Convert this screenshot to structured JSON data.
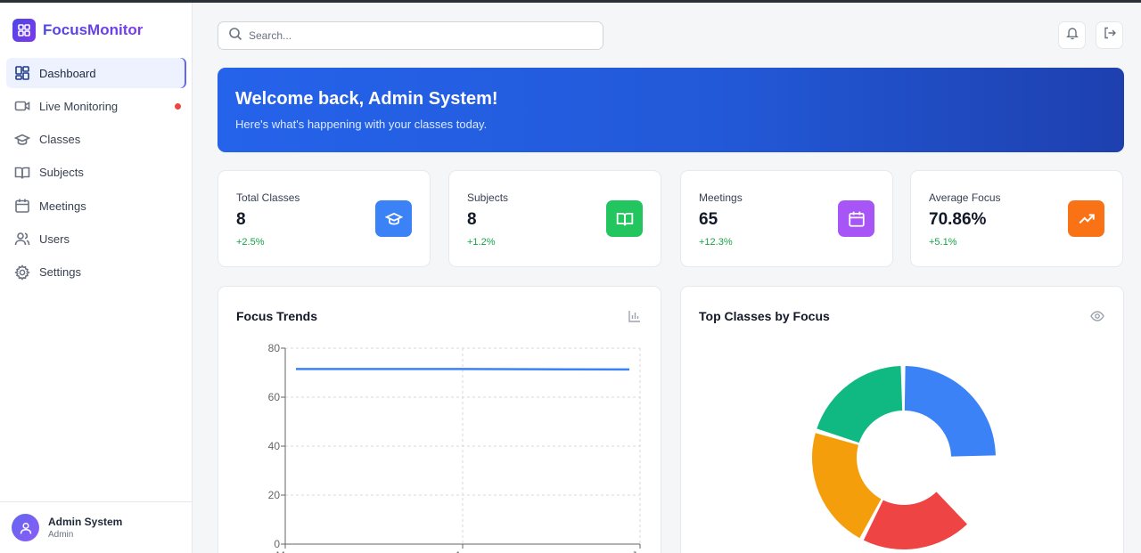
{
  "app": {
    "name": "FocusMonitor"
  },
  "sidebar": {
    "items": [
      {
        "label": "Dashboard",
        "icon": "dashboard-icon",
        "active": true
      },
      {
        "label": "Live Monitoring",
        "icon": "video-icon",
        "live": true
      },
      {
        "label": "Classes",
        "icon": "graduation-cap-icon"
      },
      {
        "label": "Subjects",
        "icon": "book-open-icon"
      },
      {
        "label": "Meetings",
        "icon": "calendar-icon"
      },
      {
        "label": "Users",
        "icon": "users-icon"
      },
      {
        "label": "Settings",
        "icon": "gear-icon"
      }
    ],
    "user": {
      "name": "Admin System",
      "role": "Admin"
    }
  },
  "header": {
    "search_placeholder": "Search...",
    "notification_icon": "bell-icon",
    "logout_icon": "logout-icon"
  },
  "welcome": {
    "title": "Welcome back, Admin System!",
    "subtitle": "Here's what's happening with your classes today."
  },
  "stats": [
    {
      "label": "Total Classes",
      "value": "8",
      "delta": "+2.5%",
      "icon": "graduation-cap-icon",
      "color": "#3b82f6"
    },
    {
      "label": "Subjects",
      "value": "8",
      "delta": "+1.2%",
      "icon": "book-open-icon",
      "color": "#22c55e"
    },
    {
      "label": "Meetings",
      "value": "65",
      "delta": "+12.3%",
      "icon": "calendar-icon",
      "color": "#a855f7"
    },
    {
      "label": "Average Focus",
      "value": "70.86%",
      "delta": "+5.1%",
      "icon": "trending-up-icon",
      "color": "#f97316"
    }
  ],
  "panels": {
    "trends": {
      "title": "Focus Trends",
      "icon": "bar-chart-icon"
    },
    "top_classes": {
      "title": "Top Classes by Focus",
      "icon": "eye-icon"
    }
  },
  "chart_data": [
    {
      "type": "line",
      "title": "Focus Trends",
      "x": [
        "Mar",
        "Apr",
        "Jun"
      ],
      "series": [
        {
          "values": [
            71.5,
            71.5,
            71.3
          ],
          "color": "#3b82f6"
        }
      ],
      "ylim": [
        0,
        80
      ],
      "yticks": [
        0,
        20,
        40,
        60,
        80
      ],
      "grid": true
    },
    {
      "type": "pie",
      "title": "Top Classes by Focus",
      "values": [
        25,
        20,
        22,
        20
      ],
      "colors": [
        "#3b82f6",
        "#10b981",
        "#f59e0b",
        "#ef4444"
      ],
      "donut": true,
      "partially_visible": true
    }
  ]
}
